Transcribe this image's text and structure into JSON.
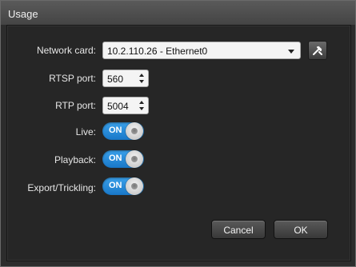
{
  "window": {
    "title": "Usage"
  },
  "fields": {
    "network_card": {
      "label": "Network card:",
      "value": "10.2.110.26 - Ethernet0"
    },
    "rtsp_port": {
      "label": "RTSP port:",
      "value": "560"
    },
    "rtp_port": {
      "label": "RTP port:",
      "value": "5004"
    },
    "live": {
      "label": "Live:",
      "state": "ON"
    },
    "playback": {
      "label": "Playback:",
      "state": "ON"
    },
    "export_trickling": {
      "label": "Export/Trickling:",
      "state": "ON"
    }
  },
  "buttons": {
    "cancel": "Cancel",
    "ok": "OK"
  },
  "icons": {
    "network_tool": "tools-icon"
  },
  "colors": {
    "toggle_on": "#1978c8"
  }
}
